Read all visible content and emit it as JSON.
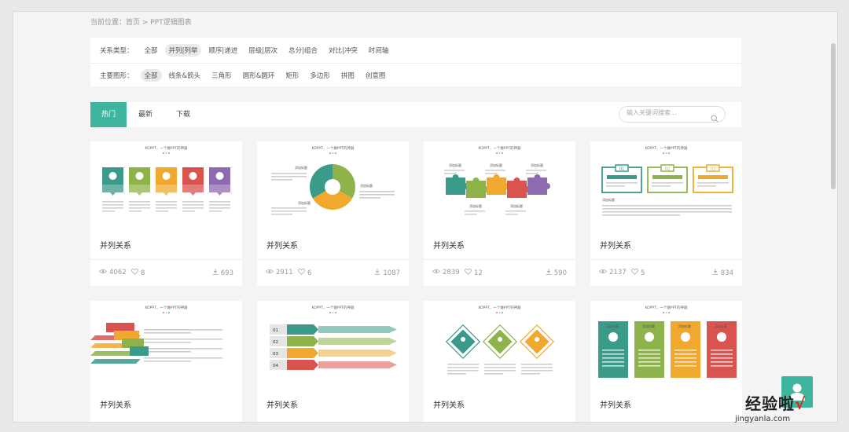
{
  "breadcrumb": "当前位置：首页 > PPT逻辑图表",
  "filters": {
    "relation": {
      "label": "关系类型：",
      "options": [
        "全部",
        "并列|列举",
        "顺序|递进",
        "层级|层次",
        "总分|组合",
        "对比|冲突",
        "时间轴"
      ],
      "selected": "并列|列举"
    },
    "shape": {
      "label": "主要图形：",
      "options": [
        "全部",
        "线条&箭头",
        "三角形",
        "圆形&圆环",
        "矩形",
        "多边形",
        "拼图",
        "创意图"
      ],
      "selected": "全部"
    }
  },
  "tabs": [
    "热门",
    "最新",
    "下载"
  ],
  "active_tab": "热门",
  "search": {
    "placeholder": "输入关键词搜索..."
  },
  "thumbnail_header": "KOPPT，一个做PPT的神器",
  "thumbnail_texts": {
    "thumb_label": "添加标题",
    "numbers": [
      "01",
      "02",
      "03",
      "04"
    ]
  },
  "cards": [
    {
      "title": "并列关系",
      "views": "4062",
      "likes": "8",
      "downloads": "693"
    },
    {
      "title": "并列关系",
      "views": "2911",
      "likes": "6",
      "downloads": "1087"
    },
    {
      "title": "并列关系",
      "views": "2839",
      "likes": "12",
      "downloads": "590"
    },
    {
      "title": "并列关系",
      "views": "2137",
      "likes": "5",
      "downloads": "834"
    },
    {
      "title": "并列关系"
    },
    {
      "title": "并列关系"
    },
    {
      "title": "并列关系"
    },
    {
      "title": "并列关系"
    }
  ],
  "watermark": {
    "text": "经验啦",
    "check": "√",
    "url": "jingyanla.com"
  },
  "colors": {
    "accent": "#3eb59e",
    "teal": "#3a9b8a",
    "olive": "#8db34a",
    "orange": "#f0a92e",
    "red": "#d9534f",
    "purple": "#8e6bb0"
  },
  "icons": [
    "search-icon",
    "eye-icon",
    "heart-icon",
    "download-icon",
    "user-icon"
  ]
}
